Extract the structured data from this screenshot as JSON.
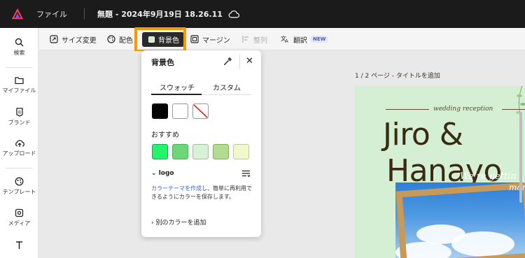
{
  "topbar": {
    "file_menu": "ファイル",
    "doc_title": "無題 - 2024年9月19日 18.26.11"
  },
  "rail": {
    "items": [
      {
        "label": "検索",
        "icon": "search-icon"
      },
      {
        "label": "マイファイル",
        "icon": "folder-icon"
      },
      {
        "label": "ブランド",
        "icon": "brand-icon"
      },
      {
        "label": "アップロード",
        "icon": "upload-icon"
      },
      {
        "label": "テンプレート",
        "icon": "template-icon"
      },
      {
        "label": "メディア",
        "icon": "media-icon"
      },
      {
        "label": "",
        "icon": "text-icon"
      }
    ]
  },
  "toolbar": {
    "resize": "サイズ変更",
    "color_scheme": "配色",
    "background": "背景色",
    "margin": "マージン",
    "arrange": "整列",
    "translate": "翻訳",
    "new_badge": "NEW"
  },
  "popover": {
    "title": "背景色",
    "tabs": [
      "スウォッチ",
      "カスタム"
    ],
    "active_tab": 0,
    "swatches": [
      {
        "name": "black",
        "color": "#000000"
      },
      {
        "name": "white",
        "color": "#ffffff"
      },
      {
        "name": "none",
        "color": "transparent"
      }
    ],
    "recommended_label": "おすすめ",
    "recommended": [
      "#22f56c",
      "#6dd679",
      "#d7f0d6",
      "#b3dc8f",
      "#f3f7cc"
    ],
    "logo_label": "logo",
    "note_link": "カラーテーマを作成",
    "note_rest": "し、簡単に再利用できるようにカラーを保存します。",
    "add_color": "別のカラーを追加"
  },
  "canvas": {
    "page_label": "1 / 2 ページ - タイトルを追加",
    "design": {
      "tagline": "wedding reception",
      "name_line1": "Jiro &",
      "name_line2": "Hanayo",
      "script_line1": "We're gettin",
      "script_line2": "mar"
    }
  }
}
